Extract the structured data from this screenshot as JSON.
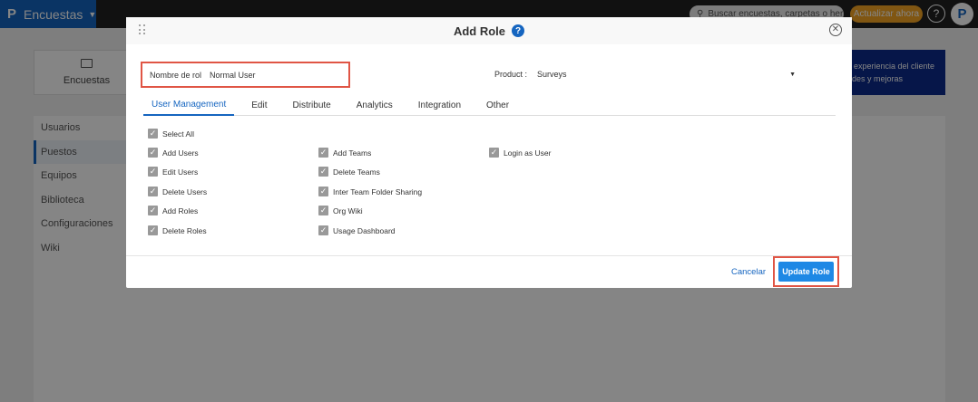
{
  "topbar": {
    "app_name": "Encuestas",
    "logo": "P",
    "search_placeholder": "Buscar encuestas, carpetas o herrami",
    "upgrade_label": "Actualizar ahora",
    "help": "?",
    "avatar": "P"
  },
  "background": {
    "surveys_card_label": "Encuestas",
    "promo_text": "y experiencia del cliente ades y mejoras",
    "side_menu": [
      "Usuarios",
      "Puestos",
      "Equipos",
      "Biblioteca",
      "Configuraciones",
      "Wiki"
    ],
    "active_side_item": "Puestos"
  },
  "modal": {
    "title": "Add Role",
    "title_help_icon": "?",
    "close_icon": "✕",
    "role_name_label": "Nombre de rol",
    "role_name_value": "Normal User",
    "product_label": "Product :",
    "product_value": "Surveys",
    "tabs": [
      "User Management",
      "Edit",
      "Distribute",
      "Analytics",
      "Integration",
      "Other"
    ],
    "active_tab": "User Management",
    "select_all": "Select All",
    "permissions_col1": [
      "Add Users",
      "Edit Users",
      "Delete Users",
      "Add Roles",
      "Delete Roles"
    ],
    "permissions_col2": [
      "Add Teams",
      "Delete Teams",
      "Inter Team Folder Sharing",
      "Org Wiki",
      "Usage Dashboard"
    ],
    "permissions_col3": [
      "Login as User"
    ],
    "cancel_label": "Cancelar",
    "update_label": "Update Role"
  },
  "colors": {
    "brand": "#1565c0",
    "highlight": "#e05545",
    "button": "#1e88e5",
    "upgrade": "#f5a623"
  }
}
